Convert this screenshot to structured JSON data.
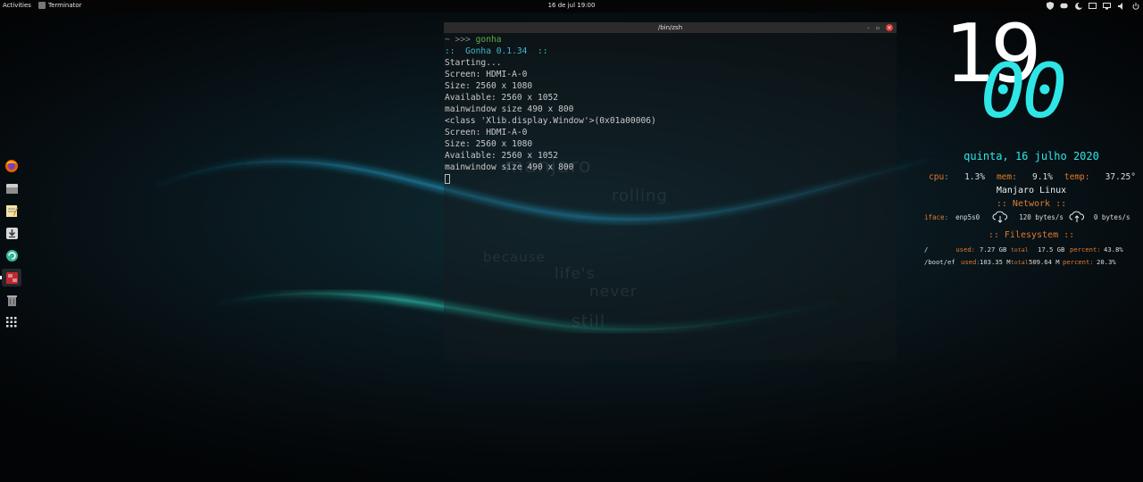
{
  "topbar": {
    "activities": "Activities",
    "app_name": "Terminator",
    "clock": "16 de jul  19:00"
  },
  "wallpaper": {
    "logo": "manjaro",
    "word1": "rolling",
    "word2": "because",
    "word3": "life's",
    "word4": "never",
    "word5": "still"
  },
  "dock": {
    "items": [
      {
        "name": "firefox"
      },
      {
        "name": "files"
      },
      {
        "name": "text-editor"
      },
      {
        "name": "downloader"
      },
      {
        "name": "software-update"
      },
      {
        "name": "terminator"
      },
      {
        "name": "trash"
      },
      {
        "name": "show-applications"
      }
    ]
  },
  "terminal": {
    "title": "/bin/zsh",
    "prompt": "~ >>> ",
    "command": "gonha",
    "gonha_banner": "::  Gonha 0.1.34  ::",
    "lines": [
      "Starting...",
      "",
      "Screen: HDMI-A-0",
      "Size: 2560 x 1080",
      "Available: 2560 x 1052",
      "mainwindow size 490 x 800",
      "<class 'Xlib.display.Window'>(0x01a00006)",
      "Screen: HDMI-A-0",
      "Size: 2560 x 1080",
      "Available: 2560 x 1052",
      "mainwindow size 490 x 800"
    ]
  },
  "conky": {
    "hour": "19",
    "minute": "00",
    "date": "quinta, 16 julho 2020",
    "cpu_label": "cpu:",
    "cpu_value": "1.3%",
    "mem_label": "mem:",
    "mem_value": "9.1%",
    "temp_label": "temp:",
    "temp_value": "37.25°",
    "os": "Manjaro Linux",
    "network_title": ":: Network ::",
    "iface_label": "iface:",
    "iface_value": "enp5s0",
    "download": "120 bytes/s",
    "upload": "0 bytes/s",
    "filesystem_title": ":: Filesystem ::",
    "fs": [
      {
        "mount": "/",
        "used_label": "used:",
        "used": "7.27 GB",
        "total_label": "total",
        "total": "17.5 GB",
        "percent_label": "percent:",
        "percent": "43.8%"
      },
      {
        "mount": "/boot/ef",
        "used_label": "used:",
        "used": "103.35 M",
        "total_label": "total",
        "total": "509.64 M",
        "percent_label": "percent:",
        "percent": "20.3%"
      }
    ]
  },
  "colors": {
    "accent_cyan": "#2fe6e6",
    "label_orange": "#e07a2e",
    "prompt_green": "#5fae43",
    "close_red": "#e23b3b"
  }
}
